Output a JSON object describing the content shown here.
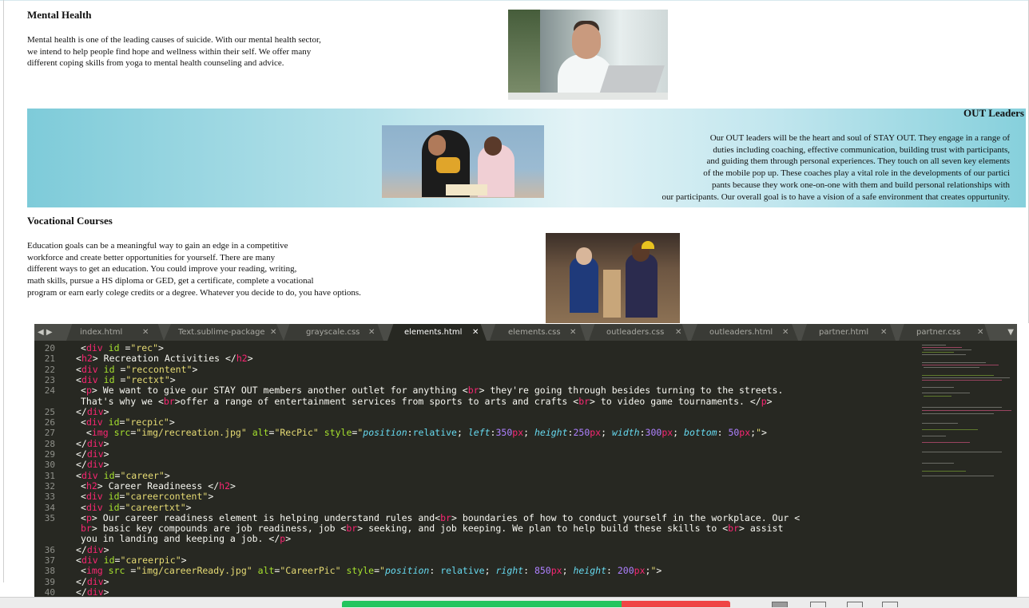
{
  "mental_health": {
    "title": "Mental Health",
    "lines": [
      "Mental health is one of the leading causes of suicide. With our mental health sector,",
      "we intend to help people find hope and wellness within their self. We offer many",
      "different coping skills from yoga to mental health counseling and advice."
    ],
    "image": "person-with-hands-on-face-photo"
  },
  "out_leaders": {
    "title": "OUT Leaders",
    "lines": [
      "Our OUT leaders will be the heart and soul of STAY OUT. They engage in a range of",
      "duties including coaching, effective communication, building trust with participants,",
      "and guiding them through personal experiences. They touch on all seven key elements",
      "of the mobile pop up. These coaches play a vital role in the developments of our partici",
      "pants because they work one-on-one with them and build personal relationships with",
      "our participants. Our overall goal is to have a vision of a safe environment that creates oppurtunity."
    ],
    "image": "mentor-reading-with-child-photo"
  },
  "vocational": {
    "title": "Vocational Courses",
    "lines": [
      "Education goals can be a meaningful way to gain an edge in a competitive",
      "workforce and create better opportunities for yourself. There are many",
      "different ways to get an education. You could improve your reading, writing,",
      "math skills, pursue a HS diploma or GED, get a certificate, complete a vocational",
      "program or earn early colege credits or a degree. Whatever you decide to do, you have options."
    ],
    "image": "woodworking-class-photo"
  },
  "editor": {
    "nav_arrows": "◀ ▶",
    "dropdown": "▼",
    "tabs": [
      {
        "label": "index.html",
        "close": "✕",
        "active": false
      },
      {
        "label": "Text.sublime-package",
        "close": "✕",
        "active": false
      },
      {
        "label": "grayscale.css",
        "close": "✕",
        "active": false
      },
      {
        "label": "elements.html",
        "close": "✕",
        "active": true
      },
      {
        "label": "elements.css",
        "close": "✕",
        "active": false
      },
      {
        "label": "outleaders.css",
        "close": "✕",
        "active": false
      },
      {
        "label": "outleaders.html",
        "close": "✕",
        "active": false
      },
      {
        "label": "partner.html",
        "close": "✕",
        "active": false
      },
      {
        "label": "partner.css",
        "close": "✕",
        "active": false
      }
    ],
    "line_numbers": [
      "20",
      "21",
      "22",
      "23",
      "24",
      "",
      "25",
      "26",
      "27",
      "28",
      "29",
      "30",
      "31",
      "32",
      "33",
      "34",
      "35",
      "",
      "",
      "36",
      "37",
      "38",
      "39",
      "40"
    ],
    "code_text": {
      "l20_id": "\"rec\"",
      "l21_text": " Recreation Activities ",
      "l22_id": "\"reccontent\"",
      "l23_id": "\"rectxt\"",
      "l24a": " We want to give our STAY OUT members another outlet for anything ",
      "l24b": " they're going through besides turning to the streets.",
      "l24c": "That's why we ",
      "l24d": "offer a range of entertainment services from sports to arts and crafts ",
      "l24e": " to video game tournaments. ",
      "l26_id": "\"recpic\"",
      "l27_src": "\"img/recreation.jpg\"",
      "l27_alt": "\"RecPic\"",
      "l31_id": "\"career\"",
      "l32_text": " Career Readineess ",
      "l33_id": "\"careercontent\"",
      "l34_id": "\"careertxt\"",
      "l35a": " Our career readiness element is helping understand rules and",
      "l35b": " boundaries of how to conduct yourself in the workplace. Our <",
      "l35c": "br",
      "l35d": "> basic key compounds are job readiness, job ",
      "l35e": " seeking, and job keeping. We plan to help build these skills to ",
      "l35f": " assist",
      "l35g": "you in landing and keeping a job. ",
      "l37_id": "\"careerpic\"",
      "l38_src": "\"img/careerReady.jpg\"",
      "l38_alt": "\"CareerPic\""
    }
  },
  "colors": {
    "editor_bg": "#272822",
    "tag": "#f92672",
    "attr": "#a6e22e",
    "string": "#e6db74",
    "property": "#66d9ef",
    "number": "#ae81ff",
    "progress_green": "#22c55e",
    "progress_red": "#ef4444"
  }
}
